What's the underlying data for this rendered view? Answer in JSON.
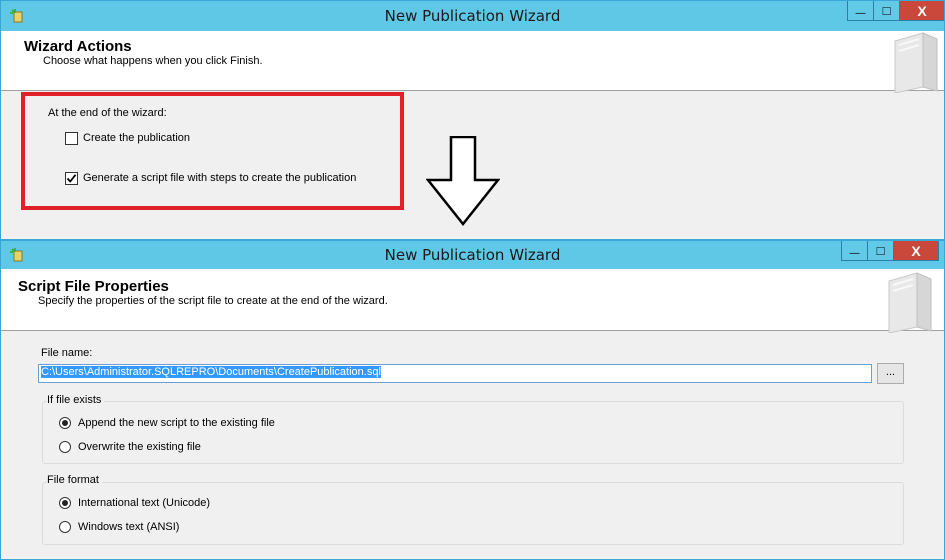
{
  "window1": {
    "title": "New Publication Wizard",
    "header": {
      "title": "Wizard Actions",
      "description": "Choose what happens when you click Finish."
    },
    "section_label": "At the end of the wizard:",
    "options": [
      {
        "label": "Create the publication",
        "checked": false
      },
      {
        "label": "Generate a script file with steps to create the publication",
        "checked": true
      }
    ],
    "controls": {
      "minimize": "—",
      "maximize": "□",
      "close": "X"
    }
  },
  "window2": {
    "title": "New Publication Wizard",
    "header": {
      "title": "Script File Properties",
      "description": "Specify the properties of the script file to create at the end of the wizard."
    },
    "file_name_label": "File name:",
    "file_name_value": "C:\\Users\\Administrator.SQLREPRO\\Documents\\CreatePublication.sql",
    "browse_label": "...",
    "if_file_exists": {
      "label": "If file exists",
      "options": [
        {
          "label": "Append the new script to the existing file",
          "selected": true
        },
        {
          "label": "Overwrite the existing file",
          "selected": false
        }
      ]
    },
    "file_format": {
      "label": "File format",
      "options": [
        {
          "label": "International text (Unicode)",
          "selected": true
        },
        {
          "label": "Windows text (ANSI)",
          "selected": false
        }
      ]
    },
    "controls": {
      "minimize": "—",
      "maximize": "□",
      "close": "X"
    }
  },
  "icons": {
    "app_icon": "publication-wizard-icon",
    "graphic": "wizard-book-graphic",
    "arrow": "down-arrow-icon"
  },
  "colors": {
    "titlebar": "#5fc8e6",
    "close_button": "#c9473b",
    "highlight_box": "#e0202a",
    "selection": "#3399ff"
  }
}
